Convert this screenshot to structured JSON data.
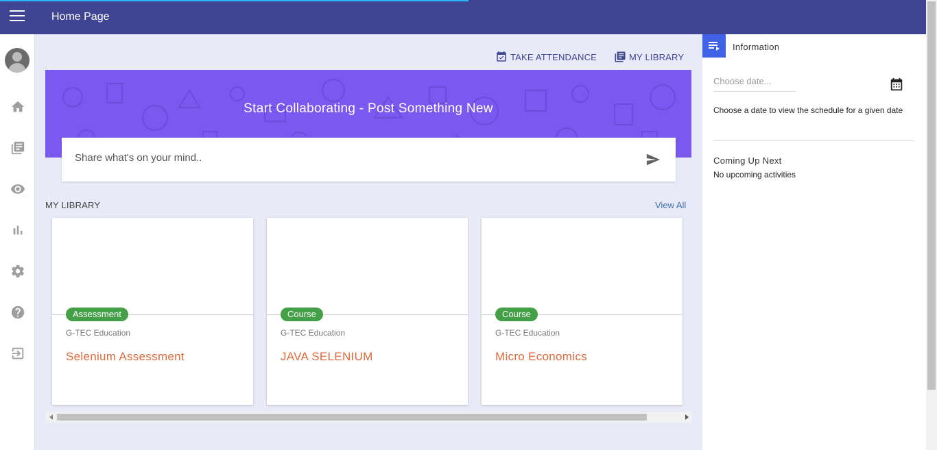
{
  "header": {
    "title": "Home Page"
  },
  "sidebar": {
    "icons": [
      "home-icon",
      "library-books-icon",
      "eye-icon",
      "bar-chart-icon",
      "gear-icon",
      "help-icon",
      "exit-icon"
    ]
  },
  "actions": {
    "take_attendance": "TAKE ATTENDANCE",
    "my_library": "MY LIBRARY"
  },
  "banner": {
    "title": "Start Collaborating - Post Something New"
  },
  "post": {
    "placeholder": "Share what's on your mind.."
  },
  "library": {
    "heading": "MY LIBRARY",
    "view_all": "View All",
    "cards": [
      {
        "badge": "Assessment",
        "org": "G-TEC Education",
        "name": "Selenium Assessment"
      },
      {
        "badge": "Course",
        "org": "G-TEC Education",
        "name": "JAVA SELENIUM"
      },
      {
        "badge": "Course",
        "org": "G-TEC Education",
        "name": "Micro Economics"
      }
    ]
  },
  "info": {
    "title": "Information",
    "date_placeholder": "Choose date...",
    "date_hint": "Choose a date to view the schedule for a given date",
    "coming_up_title": "Coming Up Next",
    "coming_up_empty": "No upcoming activities"
  },
  "colors": {
    "header": "#3f4593",
    "banner": "#7b58f0",
    "badge": "#43a047",
    "card_title": "#e0693c",
    "info_tab": "#3f62e6"
  }
}
